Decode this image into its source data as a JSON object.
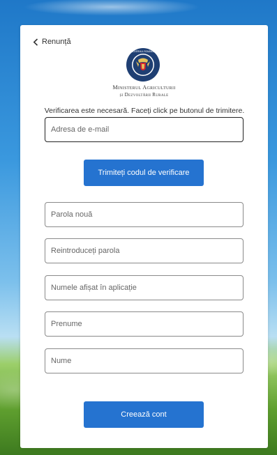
{
  "header": {
    "cancel_label": "Renunță",
    "ministry_line1": "Ministerul Agriculturii",
    "ministry_line2": "și Dezvoltării Rurale"
  },
  "logo": {
    "icon": "romanian-government-seal-icon",
    "ring_text": "GUVERNUL ROMÂNIEI"
  },
  "form": {
    "intro": "Verificarea este necesară. Faceți click pe butonul de trimitere.",
    "email_placeholder": "Adresa de e-mail",
    "send_code_label": "Trimiteți codul de verificare",
    "new_password_placeholder": "Parola nouă",
    "confirm_password_placeholder": "Reintroduceți parola",
    "display_name_placeholder": "Numele afișat în aplicație",
    "first_name_placeholder": "Prenume",
    "last_name_placeholder": "Nume",
    "create_account_label": "Creează cont"
  },
  "colors": {
    "primary_button": "#2573d0",
    "seal_blue": "#1f3f73"
  }
}
